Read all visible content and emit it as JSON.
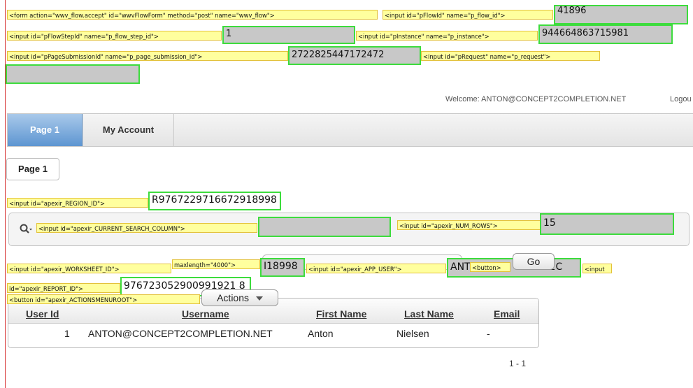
{
  "debug_tags": {
    "form": "<form action=\"wwv_flow.accept\" id=\"wwvFlowForm\" method=\"post\" name=\"wwv_flow\">",
    "flow_id": "<input id=\"pFlowId\" name=\"p_flow_id\">",
    "flow_step_id": "<input id=\"pFlowStepId\" name=\"p_flow_step_id\">",
    "instance": "<input id=\"pInstance\" name=\"p_instance\">",
    "page_submission_id": "<input id=\"pPageSubmissionId\" name=\"p_page_submission_id\">",
    "request": "<input id=\"pRequest\" name=\"p_request\">",
    "region_id": "<input id=\"apexir_REGION_ID\">",
    "current_search_column": "<input id=\"apexir_CURRENT_SEARCH_COLUMN\">",
    "num_rows": "<input id=\"apexir_NUM_ROWS\">",
    "worksheet_id": "<input id=\"apexir_WORKSHEET_ID\">",
    "maxlength": "maxlength=\"4000\">",
    "app_user": "<input id=\"apexir_APP_USER\">",
    "button": "<button>",
    "input_partial": "<input",
    "report_id": "id=\"apexir_REPORT_ID\">",
    "actions_menu_root": "<button id=\"apexir_ACTIONSMENUROOT\">"
  },
  "fields": {
    "flow_id": "41896",
    "flow_step_id": "1",
    "instance": "944664863715981",
    "page_submission_id": "2722825447172472",
    "request": "",
    "region_id": "R9767229716672918998",
    "current_search_column": "",
    "num_rows": "15",
    "worksheet_id": "I18998",
    "app_user": "ANT",
    "app_user_tail": "T2C",
    "report_id": "976723052900991921 8"
  },
  "header": {
    "welcome": "Welcome: ANTON@CONCEPT2COMPLETION.NET",
    "logout": "Logou"
  },
  "tabs": [
    {
      "label": "Page 1",
      "active": true
    },
    {
      "label": "My Account",
      "active": false
    }
  ],
  "breadcrumb": "Page 1",
  "buttons": {
    "go": "Go",
    "actions": "Actions"
  },
  "report": {
    "columns": [
      "User Id",
      "Username",
      "First Name",
      "Last Name",
      "Email"
    ],
    "rows": [
      [
        "1",
        "ANTON@CONCEPT2COMPLETION.NET",
        "Anton",
        "Nielsen",
        "-"
      ]
    ],
    "pagination": "1 - 1"
  },
  "colors": {
    "tab_active": "#5d95d1",
    "debug_tag_bg": "#ffff9e",
    "field_border": "#3ddc3d"
  }
}
